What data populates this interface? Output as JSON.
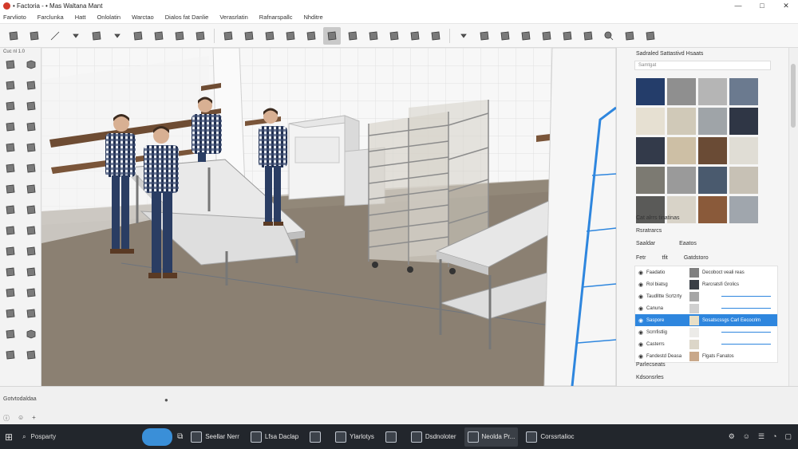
{
  "window": {
    "title": "• Factoria - • Mas Waltana Mant",
    "controls": [
      "—",
      "□",
      "✕"
    ]
  },
  "menu": [
    "Farvlioto",
    "Farclunka",
    "Hatt",
    "Onlolatin",
    "Warctao",
    "Dialos fat Danlie",
    "Verasrlatin",
    "Rafnarspallc",
    "Nhditre"
  ],
  "toolbar": {
    "icons": [
      "select-icon",
      "eraser-icon",
      "line-icon",
      "dropdown-icon",
      "shape-icon",
      "dropdown-icon",
      "paint-icon",
      "push-pull-icon",
      "move-icon",
      "rotate-icon",
      "scale-icon",
      "offset-icon",
      "tape-icon",
      "text-icon",
      "axes-icon",
      "orbit-icon",
      "pan-icon",
      "zoom-icon",
      "zoom-extents-icon",
      "component-icon",
      "section-icon",
      "dropdown-icon",
      "warehouse-icon",
      "styles-icon",
      "layers-icon",
      "scenes-icon",
      "shadows-icon",
      "materials-icon",
      "search-icon",
      "camera-icon",
      "settings-icon"
    ],
    "active_index": 15
  },
  "left_palette": {
    "header": "Cuc nl  1.0",
    "tools": [
      "pencil-icon",
      "box-icon",
      "brush-icon",
      "wood-icon",
      "ruler-icon",
      "plank-icon",
      "block-icon",
      "crate-icon",
      "barrel-icon",
      "shelf-icon",
      "chisel-icon",
      "tape-icon",
      "curve-icon",
      "wedge-icon",
      "compass-icon",
      "pliers-icon",
      "sphere-icon",
      "fan-icon",
      "panel-icon",
      "wrench-icon",
      "brush-icon",
      "hammer-icon",
      "hand-icon",
      "gauge-icon",
      "cable-icon",
      "leg-icon",
      "mug-icon",
      "box-icon",
      "hammer-icon",
      "drill-icon"
    ]
  },
  "right_panel": {
    "title": "Sadraled Sattastivd Hsaats",
    "search": "Samtgat",
    "swatch_colors": [
      "#243d6a",
      "#8f8f8f",
      "#b5b5b5",
      "#6b7a8f",
      "#e6e0d2",
      "#d0c9b8",
      "#9fa4a8",
      "#2f3645",
      "#333a4a",
      "#cdbfa5",
      "#6a4b35",
      "#e0ddd5",
      "#7c7a72",
      "#9a9a9a",
      "#4a5a6e",
      "#c7c1b5",
      "#5a5a58",
      "#d8d3c8",
      "#8a5a3a",
      "#a0a6ad"
    ],
    "section_create": "Cat alrrs tinatinas",
    "section_structures": "Rsratrarcs",
    "search_row": [
      "Saaldar",
      "Eaatos"
    ],
    "layers_header": [
      "Fetr",
      "tfit",
      "Gatdstoro"
    ],
    "layers": [
      {
        "name": "Faadatio",
        "color": "#808080",
        "desc": "Decoboct veali reas",
        "selected": false
      },
      {
        "name": "Rol biatsg",
        "color": "#3a3f46",
        "desc": "Rarcratsfi Grolics",
        "selected": false
      },
      {
        "name": "Taudlltte Scrtzrty",
        "color": "#a6a6a6",
        "desc": "",
        "selected": false
      },
      {
        "name": "Canuna",
        "color": "#d0d0d0",
        "desc": "",
        "selected": false
      },
      {
        "name": "Saspore",
        "color": "#e8dfc6",
        "desc": "Sosatscssgs  Carl Eecocrim",
        "selected": true
      },
      {
        "name": "Scrnfistlig",
        "color": "#ecebe8",
        "desc": "",
        "selected": false
      },
      {
        "name": "Casterrs",
        "color": "#dcd6c8",
        "desc": "",
        "selected": false
      },
      {
        "name": "Fandestd Deasa",
        "color": "#c9a88a",
        "desc": "Flgats Fanatos",
        "selected": false
      }
    ],
    "footer_sections": [
      "Parlecseats",
      "Kdsonsrles"
    ]
  },
  "status": {
    "text": "Gotvtodaldaa",
    "icons": [
      "info-icon",
      "user-icon",
      "plus-icon"
    ]
  },
  "taskbar": {
    "search_placeholder": "Posparty",
    "tasks": [
      {
        "label": "Seellar Nerr",
        "active": false
      },
      {
        "label": "Lfsa Daclap",
        "active": false
      },
      {
        "label": "",
        "active": false
      },
      {
        "label": "Ylarlotys",
        "active": false
      },
      {
        "label": "",
        "active": false
      },
      {
        "label": "Dsdnoloter",
        "active": false
      },
      {
        "label": "Neolda Pr...",
        "active": true
      },
      {
        "label": "Corssrtalioc",
        "active": false
      }
    ]
  }
}
